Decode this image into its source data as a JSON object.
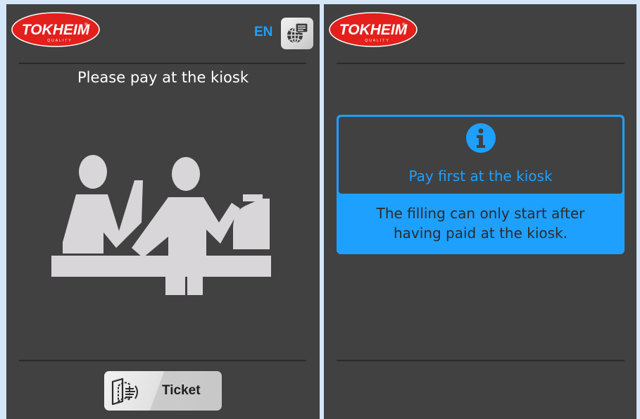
{
  "brand": {
    "logo_text": "TOKHEIM",
    "logo_subtext": "QUALITY",
    "logo_mark": "®",
    "colors": {
      "logo_red": "#e3201b",
      "accent_blue": "#1ea0ff",
      "panel_bg": "#414141"
    }
  },
  "left_screen": {
    "language": {
      "code": "EN",
      "icon": "globe-chat-icon"
    },
    "headline": "Please pay at the kiosk",
    "illustration": "kiosk-payment-icon",
    "ticket_button": {
      "label": "Ticket",
      "icon": "receipt-ticket-icon"
    }
  },
  "right_screen": {
    "info_card": {
      "icon": "info-icon",
      "title": "Pay first at the kiosk",
      "body": "The filling can only start after\nhaving paid at the kiosk."
    }
  }
}
